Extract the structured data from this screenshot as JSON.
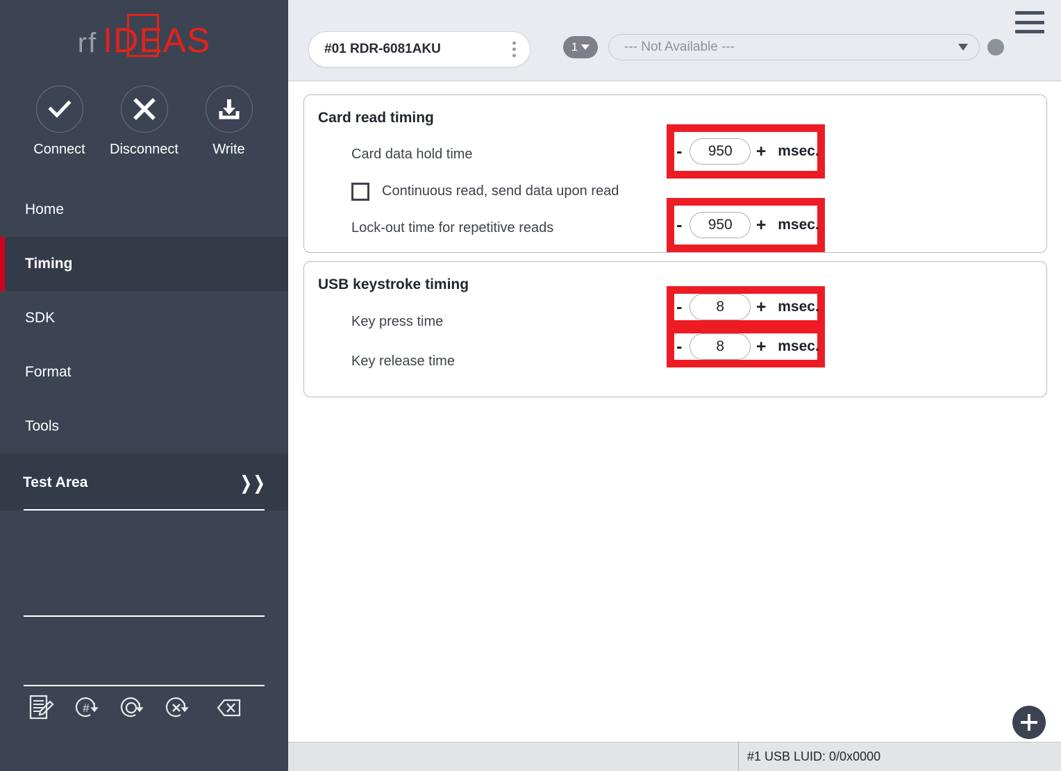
{
  "sidebar": {
    "logo": {
      "prefix": "rf",
      "name": "IDEAS"
    },
    "actions": [
      {
        "label": "Connect",
        "icon": "check-icon"
      },
      {
        "label": "Disconnect",
        "icon": "close-x-icon"
      },
      {
        "label": "Write",
        "icon": "download-write-icon"
      }
    ],
    "nav": [
      {
        "label": "Home",
        "active": false
      },
      {
        "label": "Timing",
        "active": true
      },
      {
        "label": "SDK",
        "active": false
      },
      {
        "label": "Format",
        "active": false
      },
      {
        "label": "Tools",
        "active": false
      }
    ],
    "test_area": {
      "label": "Test Area",
      "chevron": "»"
    },
    "bottom_icons": [
      "edit-document-icon",
      "hash-send-icon",
      "circle-send-icon",
      "x-send-icon",
      "backspace-delete-icon"
    ]
  },
  "topbar": {
    "device": "#01 RDR-6081AKU",
    "device_menu_icon": "kebab-menu-icon",
    "count_badge": "1",
    "dropdown_value": "--- Not Available ---",
    "status_indicator_color": "#8d9199",
    "menu_icon": "hamburger-menu-icon"
  },
  "cards": [
    {
      "title": "Card read timing",
      "rows": [
        {
          "type": "stepper",
          "label": "Card data hold time",
          "minus": "-",
          "value": "950",
          "plus": "+",
          "unit": "msec.",
          "highlighted": true
        },
        {
          "type": "checkbox",
          "label": "Continuous read, send data upon read",
          "checked": false
        },
        {
          "type": "stepper",
          "label": "Lock-out time for repetitive reads",
          "minus": "-",
          "value": "950",
          "plus": "+",
          "unit": "msec.",
          "highlighted": true
        }
      ]
    },
    {
      "title": "USB keystroke timing",
      "rows": [
        {
          "type": "stepper",
          "label": "Key press time",
          "minus": "-",
          "value": "8",
          "plus": "+",
          "unit": "msec.",
          "highlighted": true
        },
        {
          "type": "stepper",
          "label": "Key release time",
          "minus": "-",
          "value": "8",
          "plus": "+",
          "unit": "msec.",
          "highlighted": true
        }
      ]
    }
  ],
  "fab": {
    "icon": "plus-icon"
  },
  "statusbar": {
    "left": "",
    "right": "#1 USB LUID: 0/0x0000"
  },
  "colors": {
    "sidebar_bg": "#3c4453",
    "sidebar_active_bg": "#333b49",
    "accent_red": "#d0021b",
    "highlight_red": "#ed1c24",
    "logo_red": "#e2231a",
    "topbar_bg": "#e9ebf0",
    "statusbar_bg": "#e3e4e7"
  }
}
